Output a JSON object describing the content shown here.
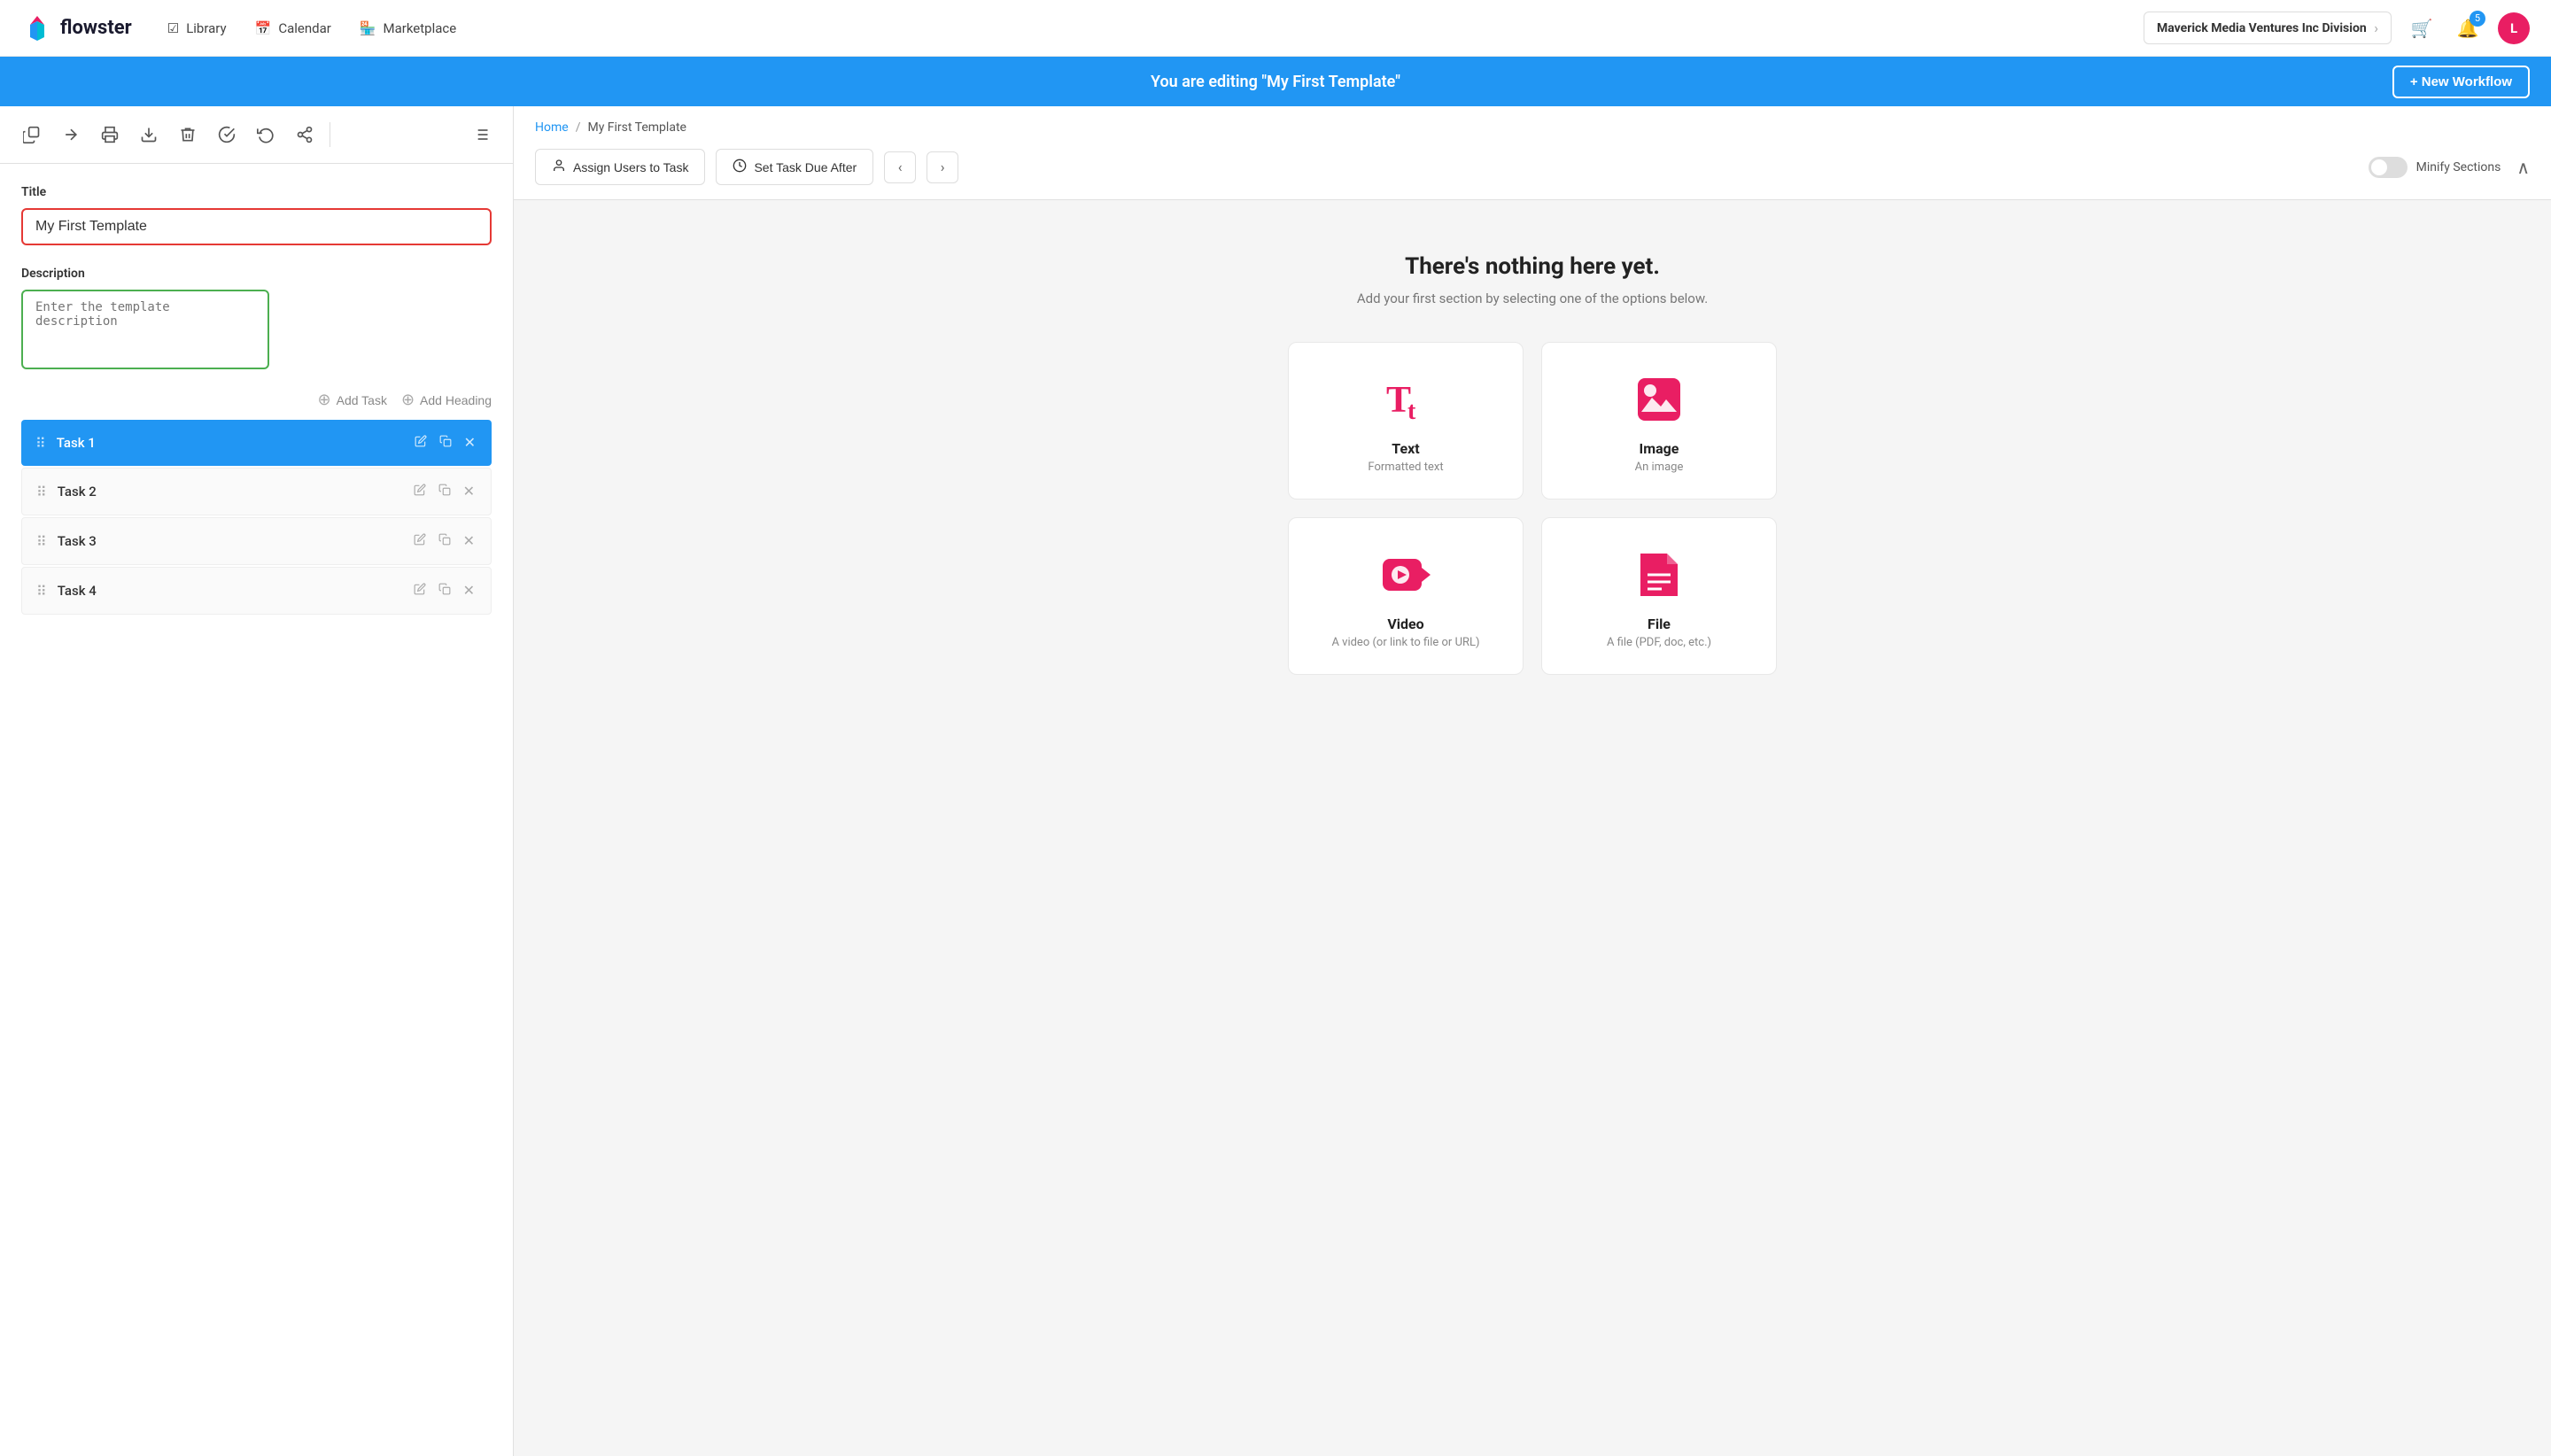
{
  "nav": {
    "logo_text": "flowster",
    "links": [
      {
        "id": "library",
        "icon": "☑",
        "label": "Library"
      },
      {
        "id": "calendar",
        "icon": "📅",
        "label": "Calendar"
      },
      {
        "id": "marketplace",
        "icon": "🏪",
        "label": "Marketplace"
      }
    ],
    "division": {
      "company": "Maverick Media Ventures Inc",
      "suffix": " Division"
    },
    "notification_count": "5",
    "avatar_letter": "L"
  },
  "banner": {
    "text": "You are editing \"My First Template\"",
    "new_workflow_label": "+ New Workflow"
  },
  "toolbar": {
    "buttons": [
      "copy",
      "arrow-right",
      "print",
      "download",
      "delete",
      "check",
      "history",
      "share",
      "list"
    ]
  },
  "left_panel": {
    "title_label": "Title",
    "title_value": "My First Template",
    "description_label": "Description",
    "description_placeholder": "Enter the template description",
    "add_task_label": "Add Task",
    "add_heading_label": "Add Heading",
    "tasks": [
      {
        "id": "task1",
        "name": "Task 1",
        "active": true
      },
      {
        "id": "task2",
        "name": "Task 2",
        "active": false
      },
      {
        "id": "task3",
        "name": "Task 3",
        "active": false
      },
      {
        "id": "task4",
        "name": "Task 4",
        "active": false
      }
    ]
  },
  "right_panel": {
    "breadcrumb": {
      "home": "Home",
      "current": "My First Template"
    },
    "actions": {
      "assign_users": "Assign Users to Task",
      "set_due": "Set Task Due After"
    },
    "minify_label": "Minify Sections",
    "empty_title": "There's nothing here yet.",
    "empty_subtitle": "Add your first section by selecting one of the options below.",
    "section_options": [
      {
        "id": "text",
        "title": "Text",
        "desc": "Formatted text"
      },
      {
        "id": "image",
        "title": "Image",
        "desc": "An image"
      },
      {
        "id": "video",
        "title": "Video",
        "desc": "A video (or link to file or URL)"
      },
      {
        "id": "file",
        "title": "File",
        "desc": "A file (PDF, doc, etc.)"
      }
    ]
  },
  "colors": {
    "primary": "#2196f3",
    "accent": "#e91e63",
    "success": "#4caf50",
    "danger": "#e53935"
  }
}
